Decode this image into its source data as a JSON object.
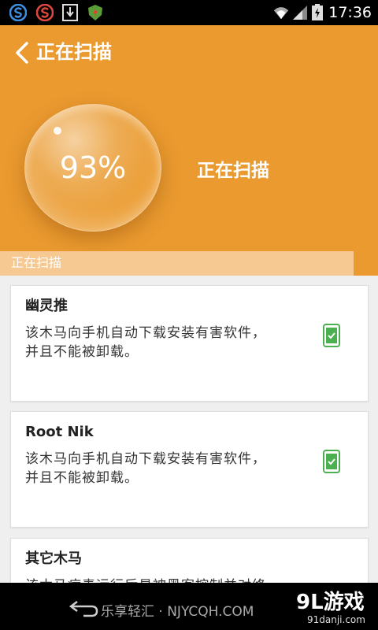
{
  "status_bar": {
    "time": "17:36",
    "icons": [
      "app-s-blue-icon",
      "app-s-red-icon",
      "download-icon",
      "shield-app-icon",
      "wifi-icon",
      "signal-icon",
      "battery-icon"
    ]
  },
  "header": {
    "title": "正在扫描",
    "percent_text": "93%",
    "status_text": "正在扫描",
    "accent_color": "#ea9a2f"
  },
  "progress": {
    "label": "正在扫描",
    "value": 0.935
  },
  "cards": [
    {
      "title": "幽灵推",
      "desc": "该木马向手机自动下载安装有害软件，并且不能被卸载。",
      "status": "safe"
    },
    {
      "title": "Root Nik",
      "desc": "该木马向手机自动下载安装有害软件，并且不能被卸载。",
      "status": "safe"
    },
    {
      "title": "其它木马",
      "desc": "该木马病毒运行后易被黑客控制并对终",
      "status": "risk"
    }
  ],
  "colors": {
    "check": "#4caf50",
    "risk": "#e84a2c"
  },
  "watermark": {
    "left_text": "乐享轻汇 · NJYCQH.COM",
    "right_logo": "9L游戏",
    "right_url": "91danji.com"
  }
}
